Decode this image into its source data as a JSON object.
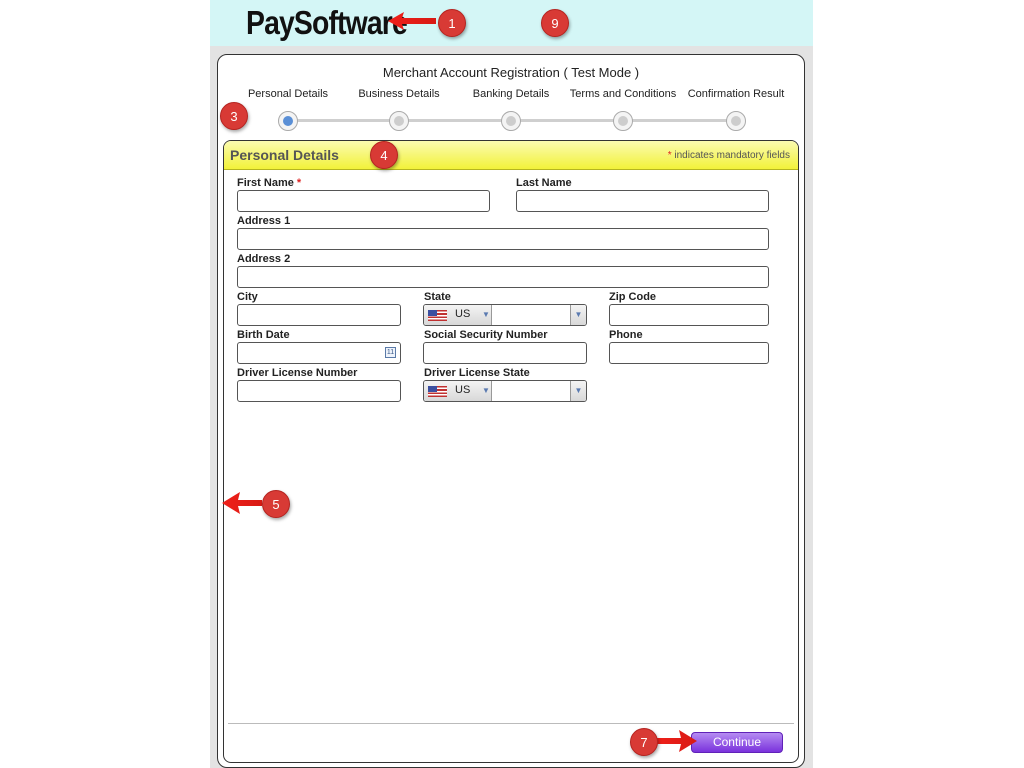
{
  "header": {
    "logo_text": "PaySoftware"
  },
  "registration": {
    "title": "Merchant Account Registration ( Test Mode )",
    "steps": [
      {
        "label": "Personal Details",
        "active": true
      },
      {
        "label": "Business Details",
        "active": false
      },
      {
        "label": "Banking Details",
        "active": false
      },
      {
        "label": "Terms and Conditions",
        "active": false
      },
      {
        "label": "Confirmation Result",
        "active": false
      }
    ]
  },
  "panel": {
    "title": "Personal Details",
    "mandatory_star": "*",
    "mandatory_note": " indicates mandatory fields"
  },
  "form": {
    "first_name": {
      "label": "First Name",
      "required_mark": "*",
      "value": ""
    },
    "last_name": {
      "label": "Last Name",
      "value": ""
    },
    "address1": {
      "label": "Address 1",
      "value": ""
    },
    "address2": {
      "label": "Address 2",
      "value": ""
    },
    "city": {
      "label": "City",
      "value": ""
    },
    "state": {
      "label": "State",
      "country_code": "US",
      "value": ""
    },
    "zip_code": {
      "label": "Zip Code",
      "value": ""
    },
    "birth_date": {
      "label": "Birth Date",
      "value": "",
      "calendar_icon_text": "11"
    },
    "ssn": {
      "label": "Social Security Number",
      "value": ""
    },
    "phone": {
      "label": "Phone",
      "value": ""
    },
    "driver_license_number": {
      "label": "Driver License Number",
      "value": ""
    },
    "driver_license_state": {
      "label": "Driver License State",
      "country_code": "US",
      "value": ""
    }
  },
  "footer": {
    "continue_label": "Continue"
  },
  "annotations": [
    {
      "number": "1",
      "arrow": true
    },
    {
      "number": "9",
      "arrow": false
    },
    {
      "number": "3",
      "arrow": false
    },
    {
      "number": "4",
      "arrow": false
    },
    {
      "number": "5",
      "arrow": true
    },
    {
      "number": "7",
      "arrow": true
    }
  ],
  "colors": {
    "banner_bg": "#d4f6f6",
    "panel_header": "#f2f23a",
    "active_step": "#5a8fd6",
    "continue_button": "#7a32dc",
    "badge": "#d83a35",
    "required_star": "#dd2222"
  }
}
